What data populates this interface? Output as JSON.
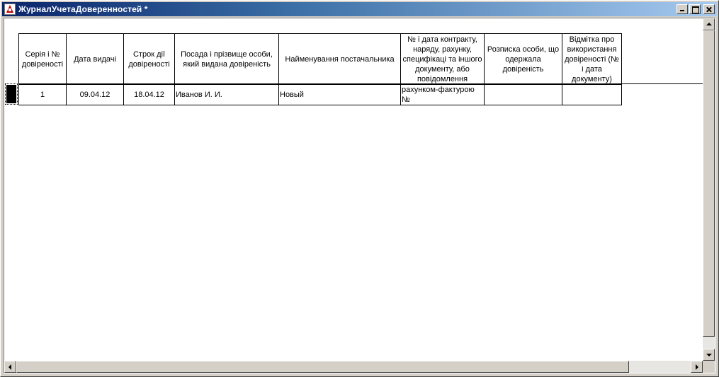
{
  "window": {
    "title": "ЖурналУчетаДоверенностей  *"
  },
  "table": {
    "headers": [
      "Серія і № довіреності",
      "Дата видачі",
      "Строк дії довіреності",
      "Посада і прізвище особи, який видана довіреність",
      "Найменування постачальника",
      "№ і дата контракту, наряду, рахунку, специфікаці та іншого документу, або повідомлення",
      "Розписка особи, що одержала довіреність",
      "Відмітка про використання довіреності (№ і дата документу)"
    ],
    "rows": [
      {
        "series": "1",
        "issue_date": "09.04.12",
        "valid_until": "18.04.12",
        "person": "Иванов И. И.",
        "supplier": "Новый",
        "document": "рахунком-фактурою №",
        "receipt": "",
        "usage_mark": ""
      }
    ]
  }
}
